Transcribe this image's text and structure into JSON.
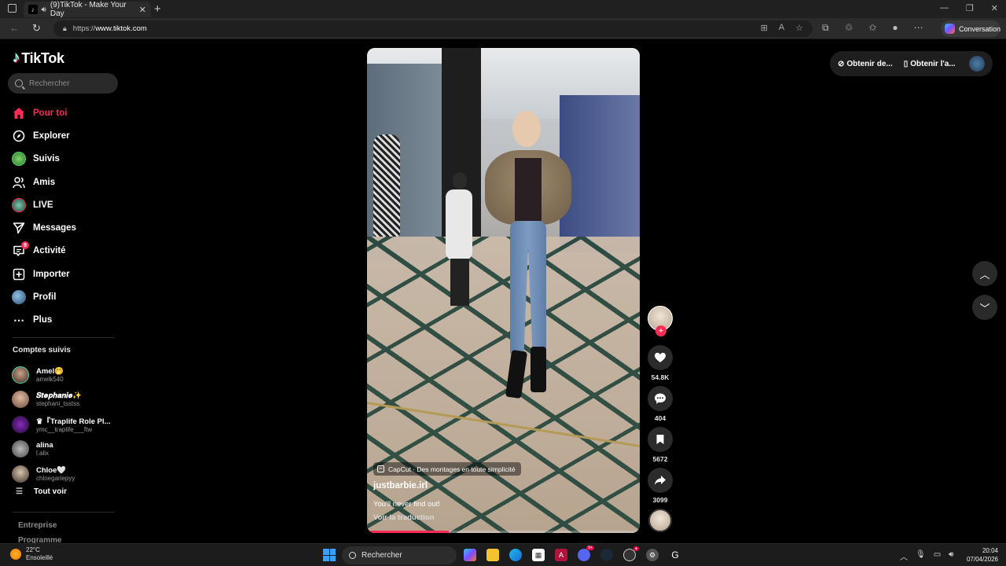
{
  "browser": {
    "tab_title": "(9)TikTok - Make Your Day",
    "url_prefix": "https://",
    "url_host": "www.tiktok.com",
    "conversation_label": "Conversation"
  },
  "sidebar": {
    "logo": "TikTok",
    "search_placeholder": "Rechercher",
    "items": [
      {
        "label": "Pour toi",
        "icon": "home-icon",
        "active": true
      },
      {
        "label": "Explorer",
        "icon": "compass-icon"
      },
      {
        "label": "Suivis",
        "icon": "following-avatar-icon"
      },
      {
        "label": "Amis",
        "icon": "friends-icon"
      },
      {
        "label": "LIVE",
        "icon": "live-icon"
      },
      {
        "label": "Messages",
        "icon": "messages-icon"
      },
      {
        "label": "Activité",
        "icon": "activity-icon",
        "badge": "9"
      },
      {
        "label": "Importer",
        "icon": "upload-icon"
      },
      {
        "label": "Profil",
        "icon": "profile-avatar-icon"
      },
      {
        "label": "Plus",
        "icon": "more-icon"
      }
    ],
    "followed_title": "Comptes suivis",
    "followed": [
      {
        "name": "Amel🤭",
        "handle": "amelk540"
      },
      {
        "name": "𝑺𝒕𝒆𝒑𝒉𝒂𝒏𝒊𝒆✨",
        "handle": "stephani_tsstss"
      },
      {
        "name": "♛『Traplife Role Pl...",
        "handle": "ymc__traplife___ftw"
      },
      {
        "name": "alina",
        "handle": "l.alix"
      },
      {
        "name": "Chloe🤍",
        "handle": "chloegariepyy"
      }
    ],
    "see_all": "Tout voir",
    "footer": [
      "Entreprise",
      "Programme"
    ]
  },
  "video": {
    "capcut": "CapCut · Des montages en toute simplicité",
    "username": "justbarbie.irl",
    "description": "You'll never find out!",
    "translate": "Voir la traduction",
    "progress": 0.3
  },
  "actions": {
    "likes": "54.8K",
    "comments": "404",
    "saves": "5672",
    "shares": "3099"
  },
  "topright": {
    "coins": "Obtenir de...",
    "app": "Obtenir l'a..."
  },
  "taskbar": {
    "temp": "22°C",
    "weather": "Ensoleillé",
    "search": "Rechercher",
    "time": "20:04",
    "date": "07/04/2026"
  },
  "colors": {
    "accent": "#fe2c55",
    "background": "#000000"
  }
}
